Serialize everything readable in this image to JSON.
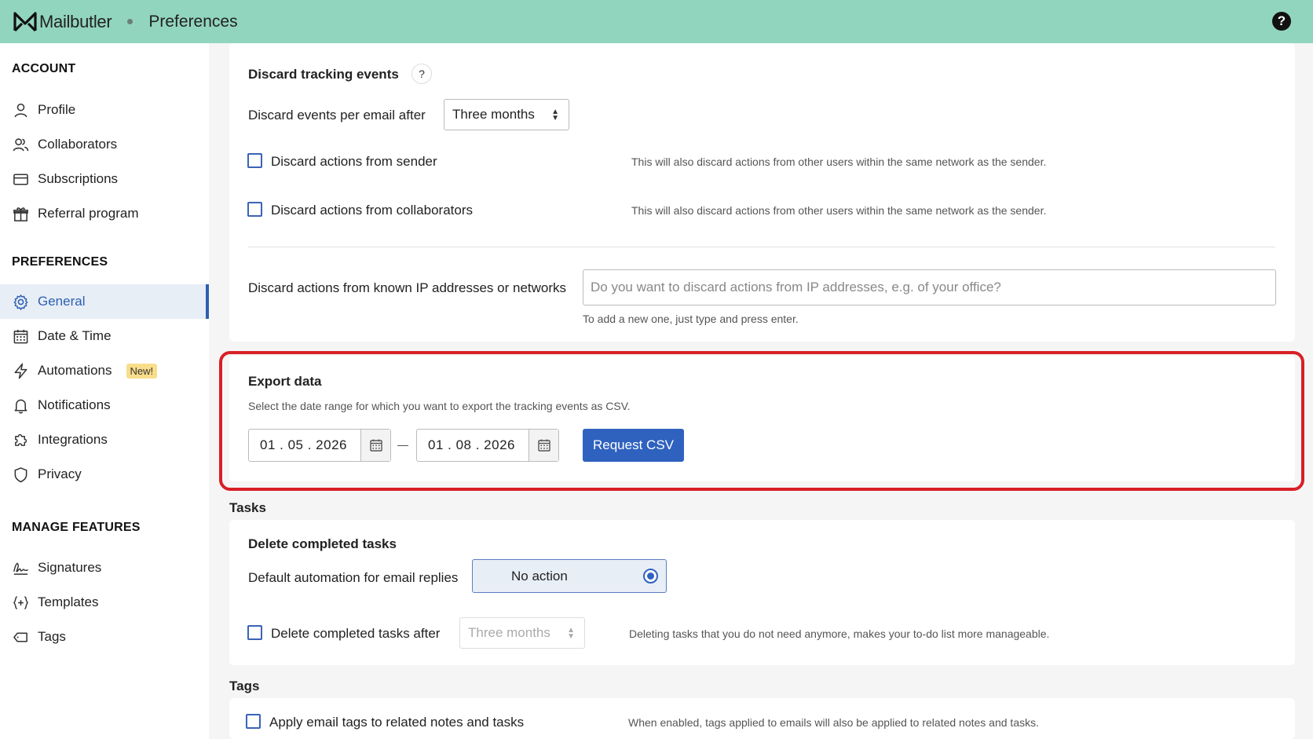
{
  "app": {
    "brand": "Mailbutler",
    "page_title": "Preferences",
    "help": "?"
  },
  "sidebar": {
    "account_heading": "ACCOUNT",
    "account_items": [
      {
        "label": "Profile",
        "icon": "user-icon"
      },
      {
        "label": "Collaborators",
        "icon": "users-icon"
      },
      {
        "label": "Subscriptions",
        "icon": "credit-card-icon"
      },
      {
        "label": "Referral program",
        "icon": "gift-icon"
      }
    ],
    "preferences_heading": "PREFERENCES",
    "preferences_items": [
      {
        "label": "General",
        "icon": "gear-icon",
        "active": true
      },
      {
        "label": "Date & Time",
        "icon": "calendar-icon"
      },
      {
        "label": "Automations",
        "icon": "lightning-icon",
        "badge": "New!"
      },
      {
        "label": "Notifications",
        "icon": "bell-icon"
      },
      {
        "label": "Integrations",
        "icon": "puzzle-icon"
      },
      {
        "label": "Privacy",
        "icon": "shield-icon"
      }
    ],
    "manage_heading": "MANAGE FEATURES",
    "manage_items": [
      {
        "label": "Signatures",
        "icon": "signature-icon"
      },
      {
        "label": "Templates",
        "icon": "braces-plus-icon"
      },
      {
        "label": "Tags",
        "icon": "tag-icon"
      }
    ]
  },
  "tracking": {
    "title": "Discard tracking events",
    "help": "?",
    "discard_after_label": "Discard events per email after",
    "discard_after_value": "Three months",
    "sender_label": "Discard actions from sender",
    "sender_hint": "This will also discard actions from other users within the same network as the sender.",
    "collab_label": "Discard actions from collaborators",
    "collab_hint": "This will also discard actions from other users within the same network as the sender.",
    "ip_label": "Discard actions from known IP addresses or networks",
    "ip_placeholder": "Do you want to discard actions from IP addresses, e.g. of your office?",
    "ip_hint": "To add a new one, just type and press enter."
  },
  "export": {
    "title": "Export data",
    "description": "Select the date range for which you want to export the tracking events as CSV.",
    "from_date": "01 . 05 . 2026",
    "to_date": "01 . 08 . 2026",
    "button": "Request CSV",
    "highlight_color": "#d81f27"
  },
  "tasks": {
    "group_title": "Tasks",
    "title": "Delete completed tasks",
    "automation_label": "Default automation for email replies",
    "automation_value": "No action",
    "delete_after_label": "Delete completed tasks after",
    "delete_after_value": "Three months",
    "delete_hint": "Deleting tasks that you do not need anymore, makes your to-do list more manageable."
  },
  "tags": {
    "group_title": "Tags",
    "apply_label": "Apply email tags to related notes and tasks",
    "apply_hint": "When enabled, tags applied to emails will also be applied to related notes and tasks."
  },
  "colors": {
    "topbar": "#92d5bf",
    "accent": "#2f62bf",
    "badge": "#f9dd8b"
  }
}
